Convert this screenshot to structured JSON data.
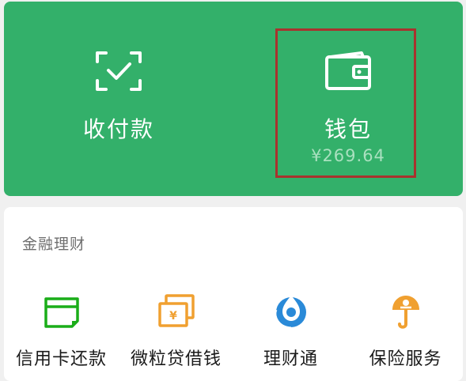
{
  "top_actions": {
    "pay_label": "收付款",
    "wallet_label": "钱包",
    "wallet_balance": "¥269.64"
  },
  "finance": {
    "section_title": "金融理财",
    "services": [
      {
        "label": "信用卡还款",
        "icon": "credit-card-icon"
      },
      {
        "label": "微粒贷借钱",
        "icon": "cash-notes-icon"
      },
      {
        "label": "理财通",
        "icon": "wealth-drop-icon"
      },
      {
        "label": "保险服务",
        "icon": "insurance-umbrella-icon"
      }
    ]
  },
  "colors": {
    "top_panel": "#33b06a",
    "highlight_border": "#a8332e",
    "icon_green": "#1aad19",
    "icon_orange": "#f0a030",
    "icon_blue": "#2a8ad8"
  }
}
